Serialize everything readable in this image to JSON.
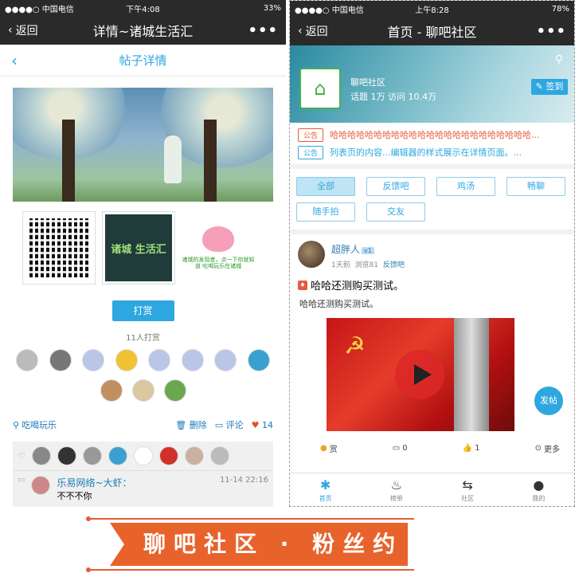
{
  "left": {
    "status": {
      "carrier": "●●●●○ 中国电信",
      "time": "下午4:08",
      "battery": "33%"
    },
    "nav": {
      "back": "返回",
      "title": "详情~诸城生活汇",
      "more": "•••"
    },
    "subnav_title": "帖子详情",
    "thumb_chalk": "诸城 生活汇",
    "thumb_pig_text": "诸城的发现者，点一下你就知道 吃喝玩乐在诸城",
    "reward_button": "打赏",
    "reward_count": "11人打赏",
    "category": "吃喝玩乐",
    "actions": {
      "delete": "删除",
      "comment": "评论",
      "likes": "14"
    },
    "comment": {
      "name": "乐易网络~大虾：",
      "time": "11-14 22:16",
      "text": "不不不你"
    }
  },
  "right": {
    "status": {
      "carrier": "●●●●○ 中国电信",
      "time": "上午8:28",
      "battery": "78%"
    },
    "nav": {
      "back": "返回",
      "title": "首页 - 聊吧社区",
      "more": "•••"
    },
    "banner": {
      "name": "聊吧社区",
      "stats": "话题 1万  访问 10.4万",
      "signin": "签到"
    },
    "notices": [
      {
        "tag": "公告",
        "text": "哈哈哈哈哈哈哈哈哈哈哈哈哈哈哈哈哈哈哈哈哈哈哈...",
        "color": "#e85a3a"
      },
      {
        "tag": "公告",
        "text": "列表页的内容...编辑器的样式展示在详情页面。...",
        "color": "#2ea7e0"
      }
    ],
    "chips": [
      "全部",
      "反馈吧",
      "鸡汤",
      "畅聊",
      "随手拍",
      "交友"
    ],
    "post": {
      "author": "超胖人",
      "vtag": "v1",
      "time": "1天前",
      "views": "浏览81",
      "category": "反馈吧",
      "title": "哈哈还测购买测试。",
      "body": "哈哈还测购买测试。"
    },
    "fab": "发帖",
    "post_actions": {
      "reward": "赏",
      "comments": "0",
      "likes": "1",
      "more": "更多"
    },
    "tabs": [
      "首页",
      "榜单",
      "社区",
      "我的"
    ]
  },
  "footer_banner": "聊吧社区 · 粉丝约"
}
